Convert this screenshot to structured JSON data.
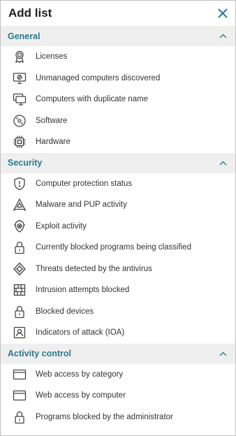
{
  "panel": {
    "title": "Add list"
  },
  "sections": [
    {
      "title": "General",
      "items": [
        {
          "label": "Licenses",
          "icon": "license-ribbon-icon"
        },
        {
          "label": "Unmanaged computers discovered",
          "icon": "unmanaged-computer-icon"
        },
        {
          "label": "Computers with duplicate name",
          "icon": "duplicate-computers-icon"
        },
        {
          "label": "Software",
          "icon": "software-disc-icon"
        },
        {
          "label": "Hardware",
          "icon": "chip-icon"
        }
      ]
    },
    {
      "title": "Security",
      "items": [
        {
          "label": "Computer protection status",
          "icon": "shield-alert-icon"
        },
        {
          "label": "Malware and PUP activity",
          "icon": "malware-icon"
        },
        {
          "label": "Exploit activity",
          "icon": "exploit-icon"
        },
        {
          "label": "Currently blocked programs being classified",
          "icon": "padlock-icon"
        },
        {
          "label": "Threats detected by the antivirus",
          "icon": "threat-icon"
        },
        {
          "label": "Intrusion attempts blocked",
          "icon": "firewall-icon"
        },
        {
          "label": "Blocked devices",
          "icon": "padlock-icon"
        },
        {
          "label": "Indicators of attack (IOA)",
          "icon": "ioa-icon"
        }
      ]
    },
    {
      "title": "Activity control",
      "items": [
        {
          "label": "Web access by category",
          "icon": "browser-window-icon"
        },
        {
          "label": "Web access by computer",
          "icon": "browser-window-icon"
        },
        {
          "label": "Programs blocked by the administrator",
          "icon": "padlock-icon"
        }
      ]
    }
  ],
  "colors": {
    "accent": "#2b7a8c",
    "section_bg": "#efefef",
    "icon_stroke": "#444444"
  }
}
